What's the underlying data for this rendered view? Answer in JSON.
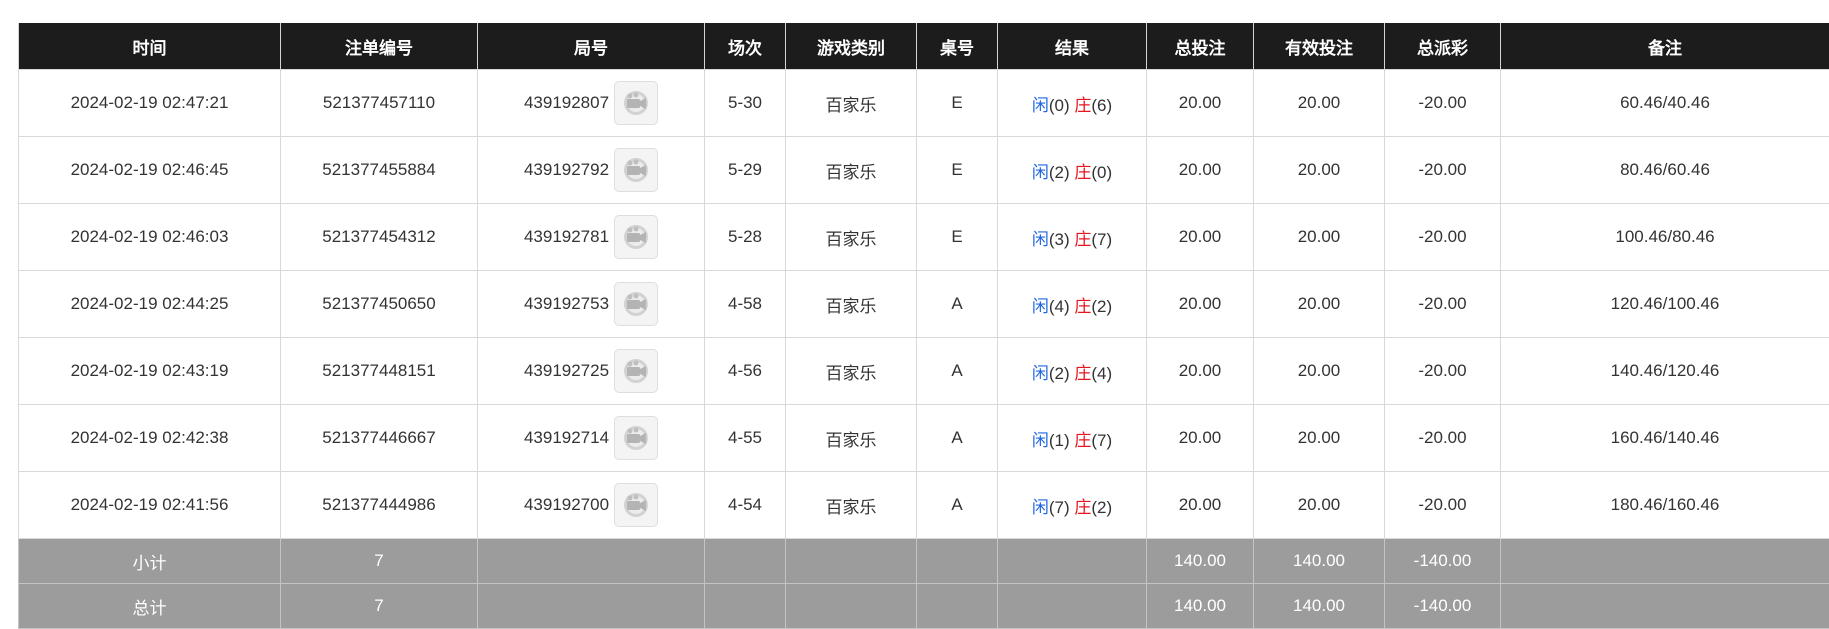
{
  "columns": [
    "时间",
    "注单编号",
    "局号",
    "场次",
    "游戏类别",
    "桌号",
    "结果",
    "总投注",
    "有效投注",
    "总派彩",
    "备注"
  ],
  "rows": [
    {
      "time": "2024-02-19 02:47:21",
      "order_no": "521377457110",
      "round_no": "439192807",
      "session": "5-30",
      "game": "百家乐",
      "table": "E",
      "player_label": "闲",
      "player_val": "(0)",
      "banker_label": "庄",
      "banker_val": "(6)",
      "total_bet": "20.00",
      "valid_bet": "20.00",
      "payout": "-20.00",
      "note": "60.46/40.46"
    },
    {
      "time": "2024-02-19 02:46:45",
      "order_no": "521377455884",
      "round_no": "439192792",
      "session": "5-29",
      "game": "百家乐",
      "table": "E",
      "player_label": "闲",
      "player_val": "(2)",
      "banker_label": "庄",
      "banker_val": "(0)",
      "total_bet": "20.00",
      "valid_bet": "20.00",
      "payout": "-20.00",
      "note": "80.46/60.46"
    },
    {
      "time": "2024-02-19 02:46:03",
      "order_no": "521377454312",
      "round_no": "439192781",
      "session": "5-28",
      "game": "百家乐",
      "table": "E",
      "player_label": "闲",
      "player_val": "(3)",
      "banker_label": "庄",
      "banker_val": "(7)",
      "total_bet": "20.00",
      "valid_bet": "20.00",
      "payout": "-20.00",
      "note": "100.46/80.46"
    },
    {
      "time": "2024-02-19 02:44:25",
      "order_no": "521377450650",
      "round_no": "439192753",
      "session": "4-58",
      "game": "百家乐",
      "table": "A",
      "player_label": "闲",
      "player_val": "(4)",
      "banker_label": "庄",
      "banker_val": "(2)",
      "total_bet": "20.00",
      "valid_bet": "20.00",
      "payout": "-20.00",
      "note": "120.46/100.46"
    },
    {
      "time": "2024-02-19 02:43:19",
      "order_no": "521377448151",
      "round_no": "439192725",
      "session": "4-56",
      "game": "百家乐",
      "table": "A",
      "player_label": "闲",
      "player_val": "(2)",
      "banker_label": "庄",
      "banker_val": "(4)",
      "total_bet": "20.00",
      "valid_bet": "20.00",
      "payout": "-20.00",
      "note": "140.46/120.46"
    },
    {
      "time": "2024-02-19 02:42:38",
      "order_no": "521377446667",
      "round_no": "439192714",
      "session": "4-55",
      "game": "百家乐",
      "table": "A",
      "player_label": "闲",
      "player_val": "(1)",
      "banker_label": "庄",
      "banker_val": "(7)",
      "total_bet": "20.00",
      "valid_bet": "20.00",
      "payout": "-20.00",
      "note": "160.46/140.46"
    },
    {
      "time": "2024-02-19 02:41:56",
      "order_no": "521377444986",
      "round_no": "439192700",
      "session": "4-54",
      "game": "百家乐",
      "table": "A",
      "player_label": "闲",
      "player_val": "(7)",
      "banker_label": "庄",
      "banker_val": "(2)",
      "total_bet": "20.00",
      "valid_bet": "20.00",
      "payout": "-20.00",
      "note": "180.46/160.46"
    }
  ],
  "subtotal": {
    "label": "小计",
    "count": "7",
    "total_bet": "140.00",
    "valid_bet": "140.00",
    "payout": "-140.00"
  },
  "grand_total": {
    "label": "总计",
    "count": "7",
    "total_bet": "140.00",
    "valid_bet": "140.00",
    "payout": "-140.00"
  },
  "icons": {
    "replay": "video-replay-icon"
  },
  "colors": {
    "header_bg": "#1c1c1c",
    "summary_bg": "#9c9c9c",
    "player_blue": "#1f66e5",
    "loss_red": "#e8141e"
  }
}
